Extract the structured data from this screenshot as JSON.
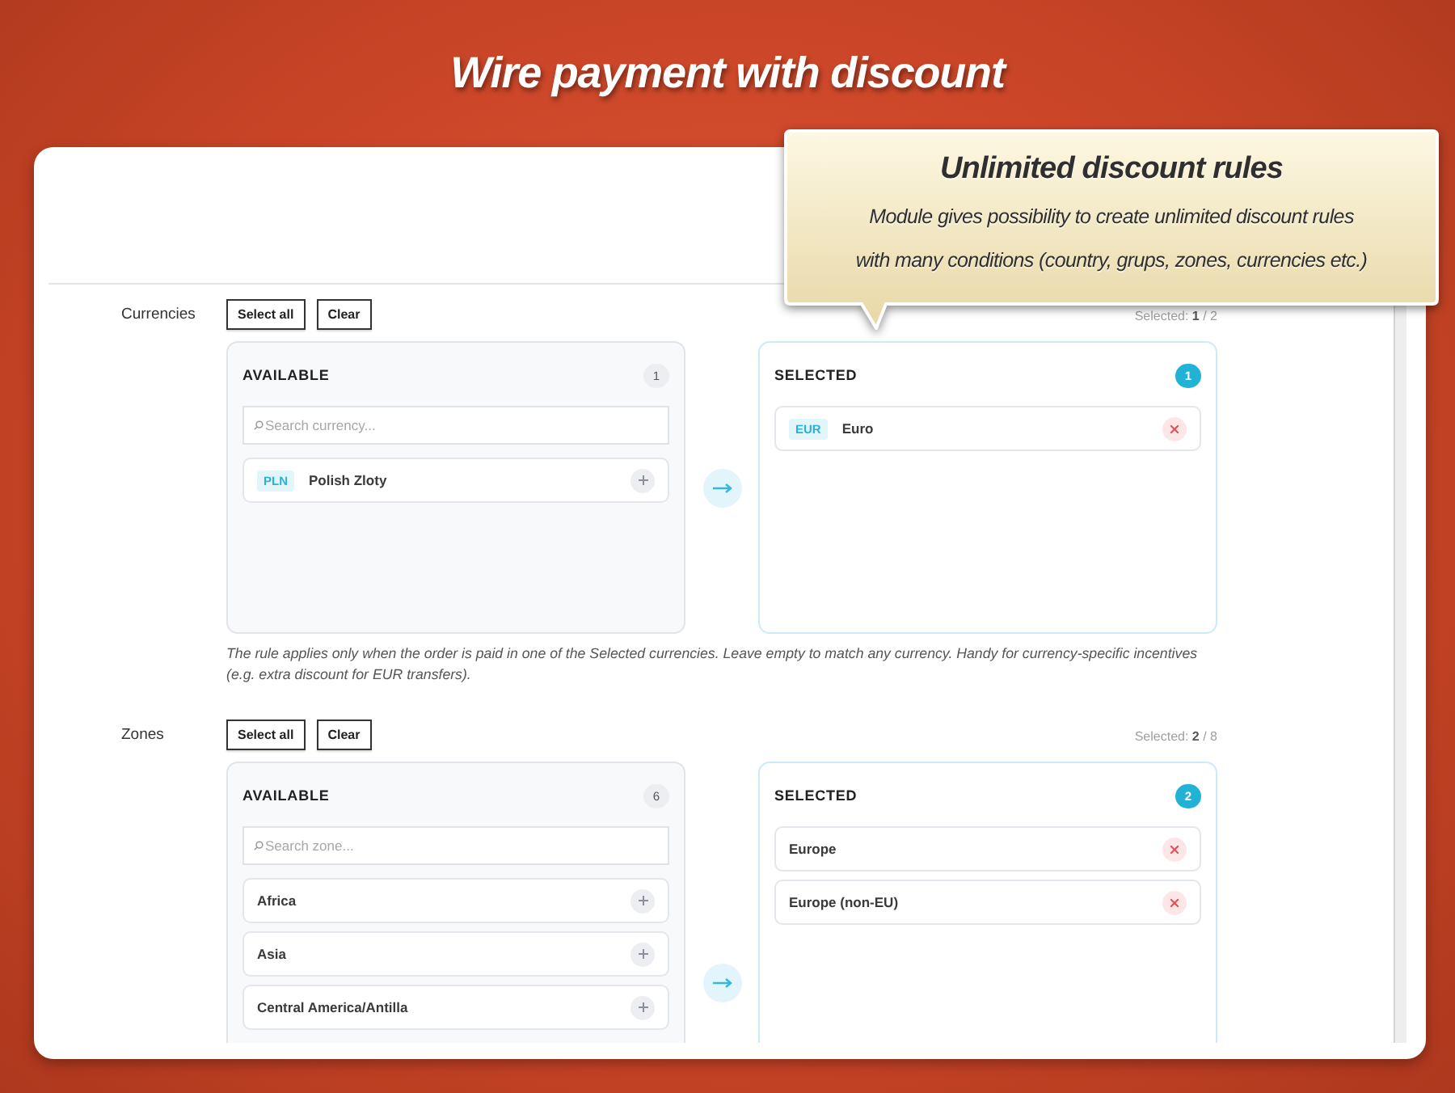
{
  "page_title": "Wire payment with discount",
  "callout": {
    "title": "Unlimited discount rules",
    "lines": [
      "Module gives possibility to create unlimited discount rules",
      "with many conditions (country, grups, zones, currencies etc.)"
    ]
  },
  "sections": [
    {
      "label": "Currencies",
      "buttons": [
        "Select all",
        "Clear"
      ],
      "summary": "Selected: **1** / 2",
      "available": {
        "title": "AVAILABLE",
        "count": "1",
        "search": {
          "placeholder": "Search currency..."
        },
        "items": [
          {
            "code": "PLN",
            "name": "Polish Zloty"
          }
        ]
      },
      "selected": {
        "title": "SELECTED",
        "count": "1",
        "items": [
          {
            "code": "EUR",
            "name": "Euro"
          }
        ]
      },
      "help": "The rule applies only when the order is paid in one of the Selected currencies. Leave empty to match any currency. Handy for currency-specific incentives (e.g. extra discount for EUR transfers)."
    },
    {
      "label": "Zones",
      "buttons": [
        "Select all",
        "Clear"
      ],
      "summary": "Selected: **2** / 8",
      "available": {
        "title": "AVAILABLE",
        "count": "6",
        "search": {
          "placeholder": "Search zone..."
        },
        "items": [
          {
            "name": "Africa"
          },
          {
            "name": "Asia"
          },
          {
            "name": "Central America/Antilla"
          }
        ]
      },
      "selected": {
        "title": "SELECTED",
        "count": "2",
        "items": [
          {
            "name": "Europe"
          },
          {
            "name": "Europe (non-EU)"
          }
        ]
      }
    }
  ]
}
